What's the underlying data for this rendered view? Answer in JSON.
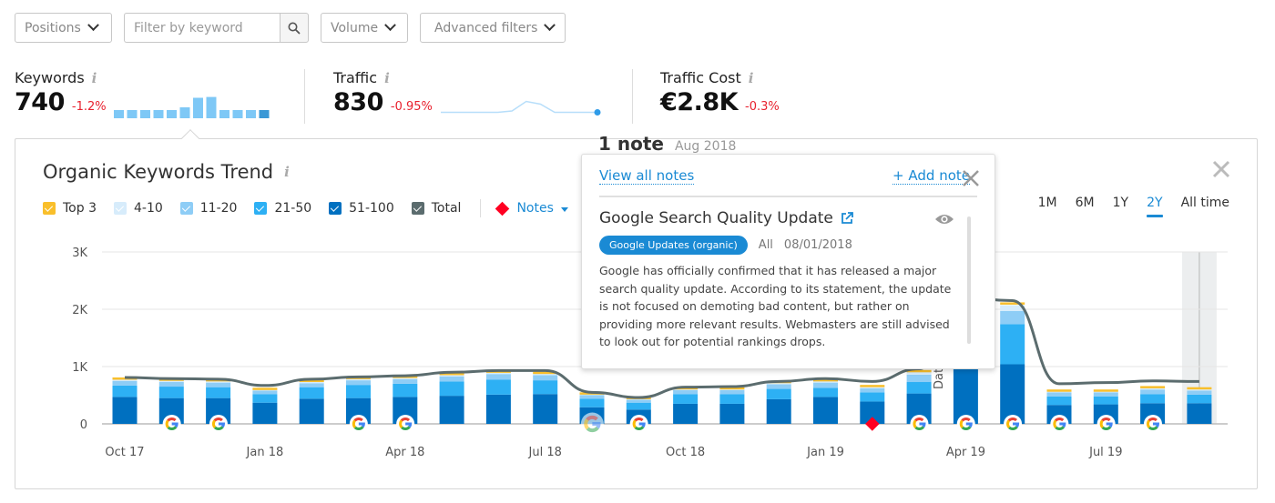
{
  "filters": {
    "positions_label": "Positions",
    "keyword_placeholder": "Filter by keyword",
    "volume_label": "Volume",
    "advanced_label": "Advanced filters"
  },
  "metrics": [
    {
      "label": "Keywords",
      "value": "740",
      "change": "-1.2%",
      "sparkline": [
        0.3,
        0.3,
        0.3,
        0.3,
        0.3,
        0.4,
        0.75,
        0.78,
        0.3,
        0.3,
        0.3,
        0.3
      ]
    },
    {
      "label": "Traffic",
      "value": "830",
      "change": "-0.95%",
      "sparkline": [
        0.15,
        0.15,
        0.15,
        0.15,
        0.15,
        0.2,
        0.55,
        0.45,
        0.15,
        0.15,
        0.15,
        0.15
      ]
    },
    {
      "label": "Traffic Cost",
      "value": "€2.8K",
      "change": "-0.3%"
    }
  ],
  "card": {
    "title": "Organic Keywords Trend",
    "legend": [
      {
        "label": "Top 3",
        "color": "#f9bf2b"
      },
      {
        "label": "4-10",
        "color": "#d7ecfb"
      },
      {
        "label": "11-20",
        "color": "#8ecdf6"
      },
      {
        "label": "21-50",
        "color": "#2db0f4"
      },
      {
        "label": "51-100",
        "color": "#0070c0"
      },
      {
        "label": "Total",
        "color": "#5b6c6e"
      }
    ],
    "notes_label": "Notes",
    "periods": [
      "1M",
      "6M",
      "1Y",
      "2Y",
      "All time"
    ],
    "active_period": "2Y"
  },
  "chart_data": {
    "type": "bar",
    "title": "Organic Keywords Trend",
    "xlabel": "",
    "ylabel": "",
    "ylim": [
      0,
      3000
    ],
    "yticks": [
      "0",
      "1K",
      "2K",
      "3K"
    ],
    "xtick_labels": [
      {
        "label": "Oct 17",
        "index": 0
      },
      {
        "label": "Jan 18",
        "index": 3
      },
      {
        "label": "Apr 18",
        "index": 6
      },
      {
        "label": "Jul 18",
        "index": 9
      },
      {
        "label": "Oct 18",
        "index": 12
      },
      {
        "label": "Jan 19",
        "index": 15
      },
      {
        "label": "Apr 19",
        "index": 18
      },
      {
        "label": "Jul 19",
        "index": 21
      }
    ],
    "categories": [
      "Oct 17",
      "Nov 17",
      "Dec 17",
      "Jan 18",
      "Feb 18",
      "Mar 18",
      "Apr 18",
      "May 18",
      "Jun 18",
      "Jul 18",
      "Aug 18",
      "Sep 18",
      "Oct 18",
      "Nov 18",
      "Dec 18",
      "Jan 19",
      "Feb 19",
      "Mar 19",
      "Apr 19",
      "May 19",
      "Jun 19",
      "Jul 19",
      "Aug 19",
      "Sep 19"
    ],
    "series": [
      {
        "name": "51-100",
        "values": [
          470,
          450,
          450,
          370,
          440,
          450,
          470,
          490,
          510,
          520,
          290,
          250,
          350,
          350,
          430,
          470,
          390,
          530,
          1000,
          1040,
          330,
          340,
          360,
          360
        ]
      },
      {
        "name": "21-50",
        "values": [
          200,
          200,
          190,
          150,
          200,
          230,
          230,
          250,
          260,
          240,
          150,
          120,
          170,
          170,
          180,
          160,
          160,
          200,
          550,
          700,
          150,
          140,
          160,
          150
        ]
      },
      {
        "name": "11-20",
        "values": [
          80,
          80,
          80,
          60,
          70,
          80,
          80,
          90,
          100,
          90,
          60,
          50,
          70,
          70,
          80,
          90,
          70,
          130,
          200,
          230,
          70,
          70,
          80,
          70
        ]
      },
      {
        "name": "4-10",
        "values": [
          40,
          40,
          40,
          30,
          40,
          40,
          40,
          40,
          40,
          40,
          30,
          30,
          30,
          30,
          40,
          40,
          40,
          60,
          100,
          100,
          30,
          30,
          40,
          40
        ]
      },
      {
        "name": "Top 3",
        "values": [
          20,
          20,
          20,
          20,
          20,
          20,
          20,
          20,
          20,
          20,
          20,
          20,
          20,
          20,
          20,
          20,
          20,
          20,
          50,
          50,
          20,
          20,
          20,
          20
        ]
      }
    ],
    "total_line": [
      810,
      790,
      780,
      670,
      780,
      820,
      840,
      900,
      930,
      930,
      550,
      460,
      640,
      650,
      740,
      790,
      740,
      960,
      2200,
      2150,
      700,
      720,
      750,
      740
    ],
    "google_update_markers": [
      1,
      2,
      5,
      6,
      10,
      11,
      17,
      18,
      19,
      20,
      21,
      22
    ],
    "highlighted_marker_index": 10,
    "note_marker_index": 16,
    "hover_index": 23
  },
  "note_popup": {
    "count_label": "1 note",
    "month": "Aug 2018",
    "view_all": "View all notes",
    "add_note": "+ Add note",
    "title": "Google Search Quality Update",
    "badge": "Google Updates (organic)",
    "scope": "All",
    "date": "08/01/2018",
    "body": "Google has officially confirmed that it has released a major search quality update. According to its statement, the update is not focused on demoting bad content, but rather on providing more relevant results. Webmasters are still advised to look out for potential rankings drops."
  },
  "side_label": "Dat"
}
